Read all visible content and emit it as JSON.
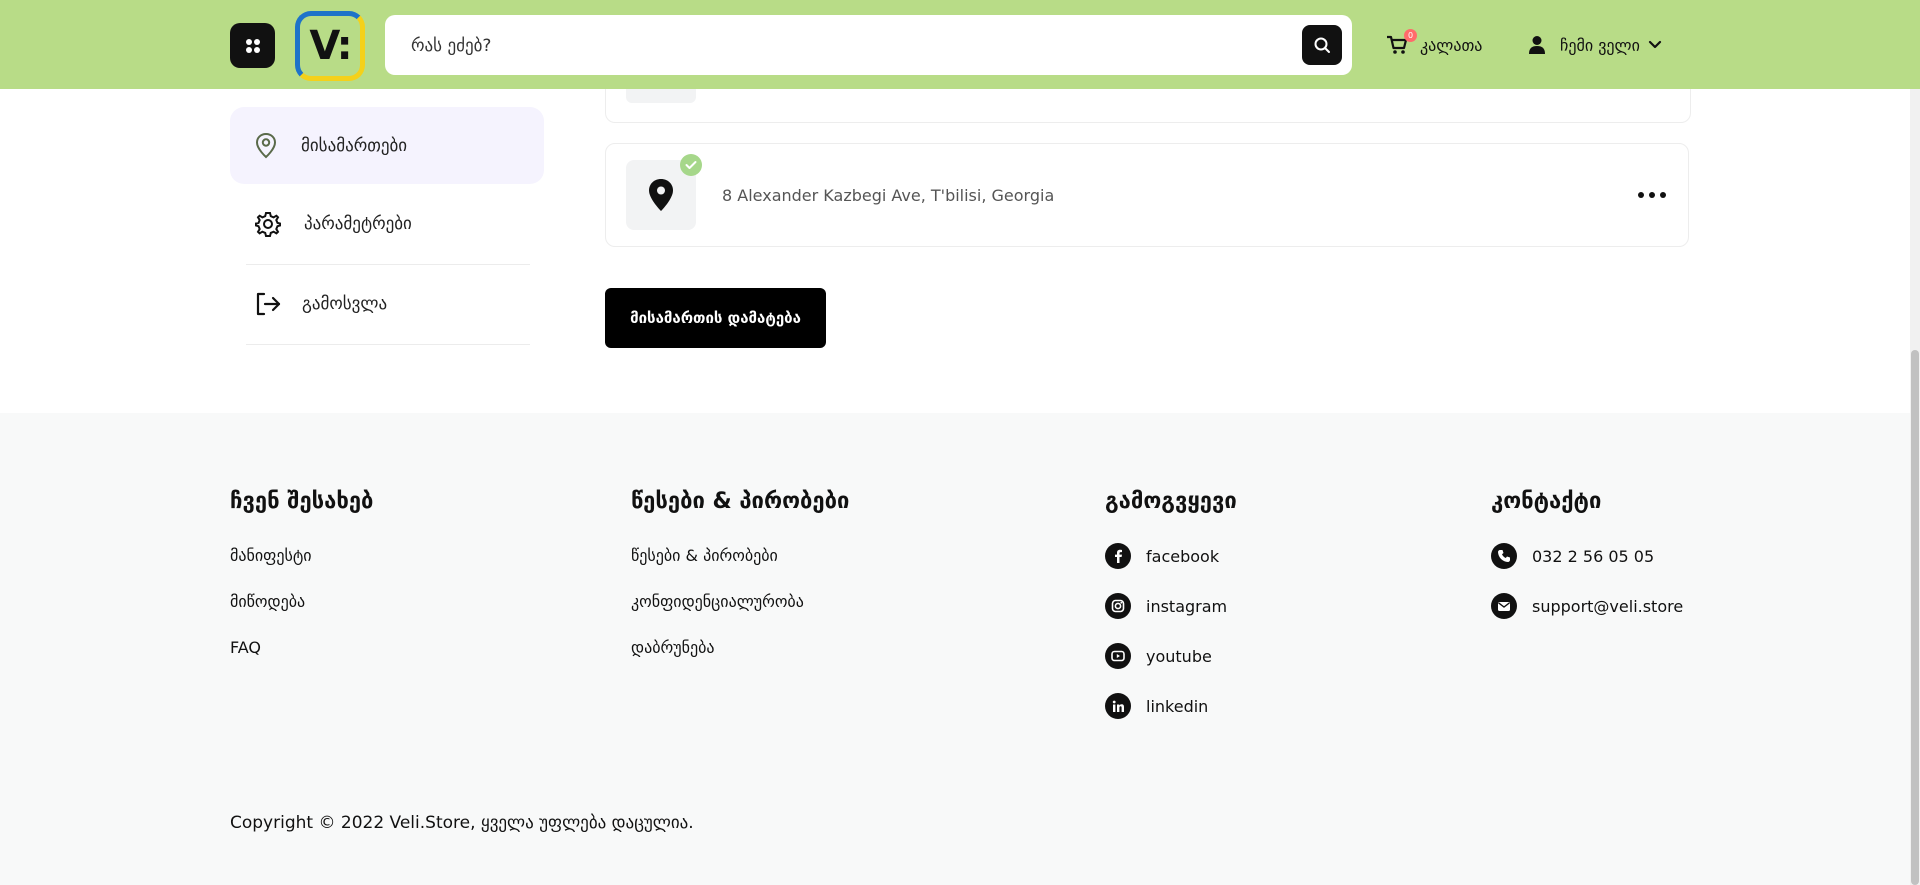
{
  "header": {
    "search_placeholder": "რას ეძებ?",
    "logo_text": "V:",
    "cart_label": "კალათა",
    "cart_count": "0",
    "account_label": "ჩემი ველი",
    "colors": {
      "header_bg": "#b8dc87",
      "logo_border_top": "#1d73c9",
      "logo_border_bottom": "#f4d11a"
    }
  },
  "sidebar": {
    "items": [
      {
        "label": "მისამართები",
        "icon": "location-pin-icon",
        "active": true
      },
      {
        "label": "პარამეტრები",
        "icon": "gear-icon"
      },
      {
        "label": "გამოსვლა",
        "icon": "logout-icon"
      }
    ]
  },
  "addresses": [
    {
      "text": "8 Alexander Kazbegi Ave, T'bilisi, Georgia",
      "selected": true
    }
  ],
  "add_address_label": "მისამართის დამატება",
  "footer": {
    "about": {
      "title": "ჩვენ შესახებ",
      "links": [
        "მანიფესტი",
        "მიწოდება",
        "FAQ"
      ]
    },
    "terms": {
      "title": "წესები & პირობები",
      "links": [
        "წესები & პირობები",
        "კონფიდენციალურობა",
        "დაბრუნება"
      ]
    },
    "follow": {
      "title": "გამოგვყევი",
      "links": [
        {
          "label": "facebook",
          "icon": "facebook-icon"
        },
        {
          "label": "instagram",
          "icon": "instagram-icon"
        },
        {
          "label": "youtube",
          "icon": "youtube-icon"
        },
        {
          "label": "linkedin",
          "icon": "linkedin-icon"
        }
      ]
    },
    "contact": {
      "title": "კონტაქტი",
      "phone": "032 2 56 05 05",
      "email": "support@veli.store"
    },
    "copyright": "Copyright © 2022 Veli.Store, ყველა უფლება დაცულია."
  }
}
